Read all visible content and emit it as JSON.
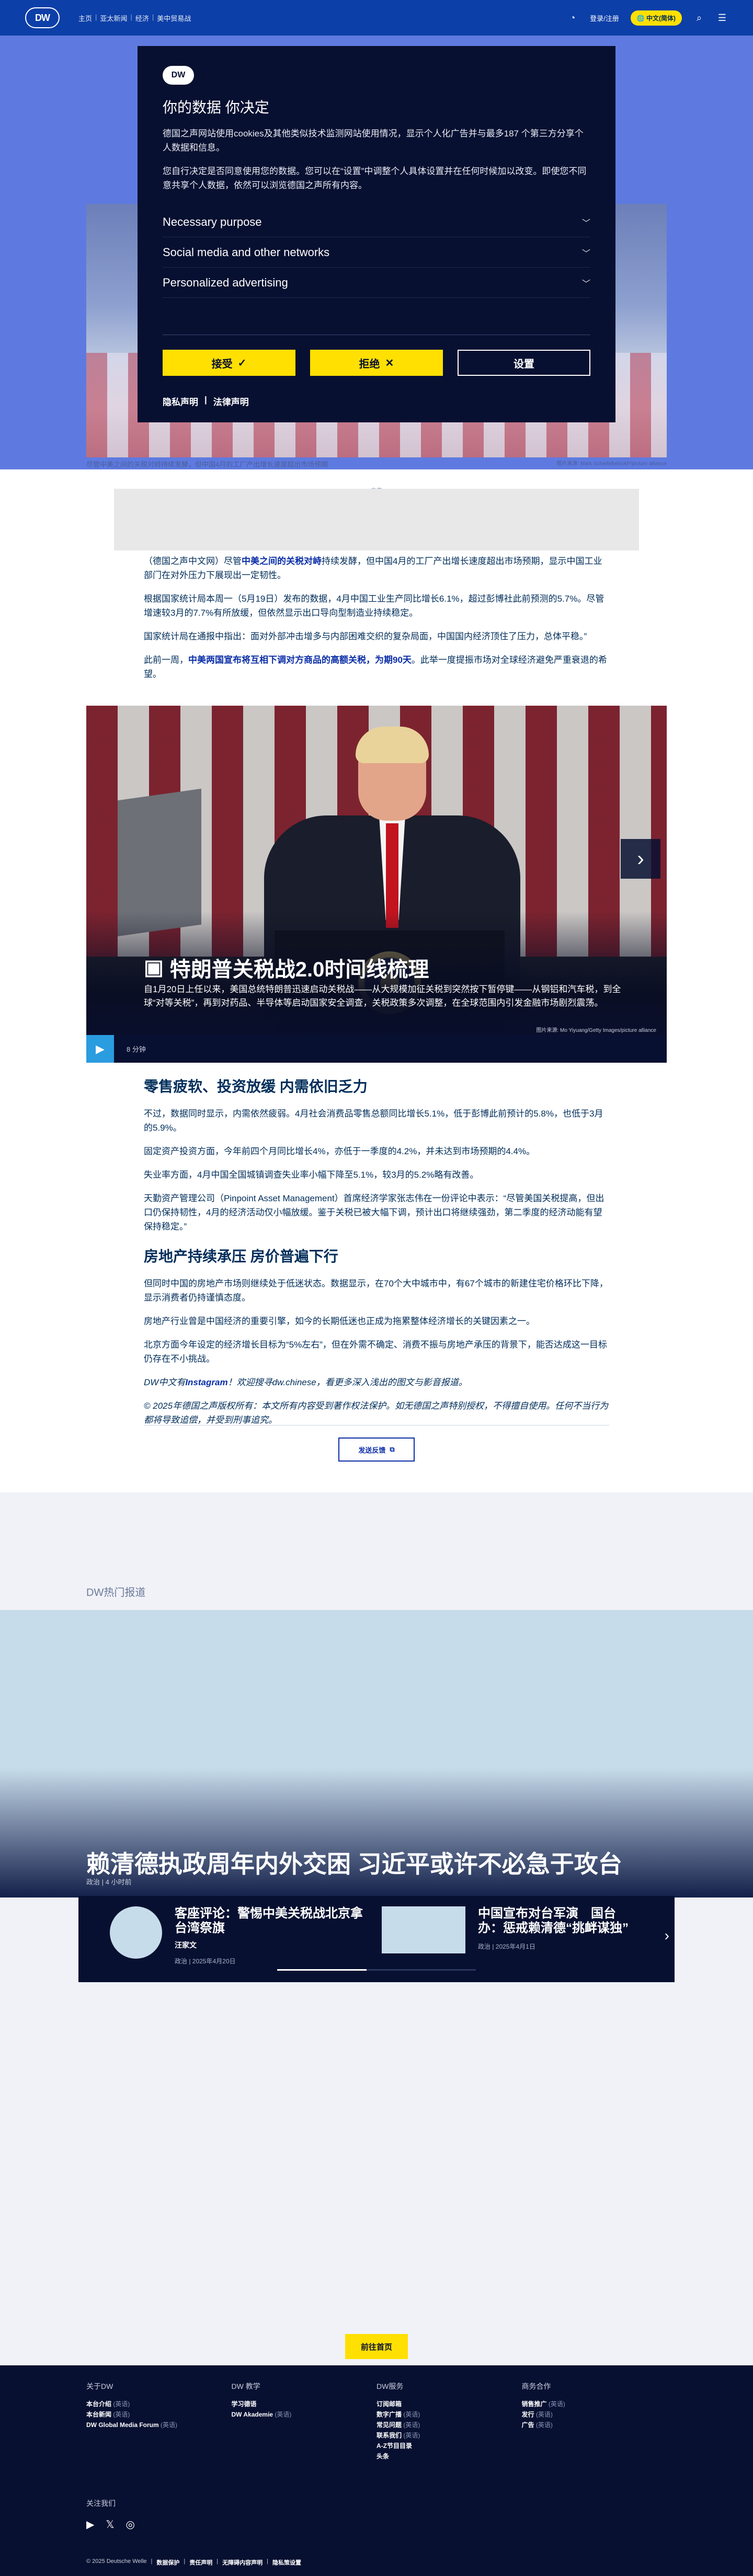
{
  "header": {
    "logo": "DW",
    "breadcrumbs": [
      "主页",
      "亚太新闻",
      "经济",
      "美中贸易战"
    ],
    "login_label": "登录/注册",
    "language_label": "中文(简体)",
    "search_icon": "search-icon",
    "menu_icon": "menu-icon"
  },
  "hero": {
    "caption": "尽管中美之间的关税对峙持续发酵，但中国4月的工厂产出增长速度超出市场预期",
    "credit": "图片来源: Mark Schiefelbein/AP/picture alliance"
  },
  "consent": {
    "logo": "DW",
    "title": "你的数据 你决定",
    "para1": "德国之声网站使用cookies及其他类似技术监测网站使用情况，显示个人化广告并与最多187 个第三方分享个人数据和信息。",
    "para2": "您自行决定是否同意使用您的数据。您可以在“设置”中调整个人具体设置并在任何时候加以改变。即使您不同意共享个人数据，依然可以浏览德国之声所有内容。",
    "rows": [
      "Necessary purpose",
      "Social media and other networks",
      "Personalized advertising"
    ],
    "accept_label": "接受",
    "reject_label": "拒绝",
    "settings_label": "设置",
    "privacy_link": "隐私声明",
    "legal_link": "法律声明"
  },
  "ad_label": "广告",
  "article": {
    "p1_pre": "（德国之声中文网）尽管",
    "p1_link": "中美之间的关税对峙",
    "p1_post": "持续发酵，但中国4月的工厂产出增长速度超出市场预期，显示中国工业部门在对外压力下展现出一定韧性。",
    "p2": "根据国家统计局本周一（5月19日）发布的数据，4月中国工业生产同比增长6.1%，超过彭博社此前预测的5.7%。尽管增速较3月的7.7%有所放缓，但依然显示出口导向型制造业持续稳定。",
    "p3": "国家统计局在通报中指出：面对外部冲击增多与内部困难交织的复杂局面，中国国内经济顶住了压力，总体平稳。”",
    "p4_pre": "此前一周，",
    "p4_link": "中美两国宣布将互相下调对方商品的高额关税，为期90天",
    "p4_post": "。此举一度提振市场对全球经济避免严重衰退的希望。"
  },
  "video": {
    "title": "特朗普关税战2.0时间线梳理",
    "description": "自1月20日上任以来，美国总统特朗普迅速启动关税战——从大规模加征关税到突然按下暂停键——从钢铝和汽车税，到全球“对等关税”，再到对药品、半导体等启动国家安全调查，关税政策多次调整，在全球范围内引发金融市场剧烈震荡。",
    "credit": "图片来源: Mo Yiyuang/Getty Images/picture alliance",
    "duration": "8 分钟"
  },
  "article2": {
    "h1": "零售疲软、投资放缓 内需依旧乏力",
    "p1": "不过，数据同时显示，内需依然疲弱。4月社会消费品零售总额同比增长5.1%，低于彭博此前预计的5.8%，也低于3月的5.9%。",
    "p2": "固定资产投资方面，今年前四个月同比增长4%，亦低于一季度的4.2%，并未达到市场预期的4.4%。",
    "p3": "失业率方面，4月中国全国城镇调查失业率小幅下降至5.1%，较3月的5.2%略有改善。",
    "p4": "天勤资产管理公司（Pinpoint Asset Management）首席经济学家张志伟在一份评论中表示：“尽管美国关税提高，但出口仍保持韧性，4月的经济活动仅小幅放缓。鉴于关税已被大幅下调，预计出口将继续强劲，第二季度的经济动能有望保持稳定。”",
    "h2": "房地产持续承压 房价普遍下行",
    "p5": "但同时中国的房地产市场则继续处于低迷状态。数据显示，在70个大中城市中，有67个城市的新建住宅价格环比下降，显示消费者仍持谨慎态度。",
    "p6": "房地产行业曾是中国经济的重要引擎，如今的长期低迷也正成为拖累整体经济增长的关键因素之一。",
    "p7": "北京方面今年设定的经济增长目标为“5%左右”，但在外需不确定、消费不振与房地产承压的背景下，能否达成这一目标仍存在不小挑战。",
    "note_pre": "DW中文有",
    "note_link": "Instagram",
    "note_post": "！欢迎搜寻dw.chinese，看更多深入浅出的图文与影音报道。",
    "copyright": "© 2025年德国之声版权所有：本文所有内容受到著作权法保护。如无德国之声特别授权，不得擅自使用。任何不当行为都将导致追偿，并受到刑事追究。",
    "feedback_label": "发送反馈"
  },
  "popular": {
    "label": "DW热门报道",
    "headline": "赖清德执政周年内外交困 习近平或许不必急于攻台",
    "meta": "政治 | 4 小时前",
    "items": [
      {
        "title": "客座评论：警惕中美关税战北京拿台湾祭旗",
        "author": "汪家文",
        "meta": "政治 | 2025年4月20日"
      },
      {
        "title": "中国宣布对台军演　国台办：惩戒赖清德“挑衅谋独”",
        "author": "",
        "meta": "政治 | 2025年4月1日"
      }
    ],
    "home_label": "前往首页"
  },
  "footer": {
    "cols": [
      {
        "title": "关于DW",
        "items": [
          [
            "本台介绍",
            "(英语)"
          ],
          [
            "本台新闻",
            "(英语)"
          ],
          [
            "DW Global Media Forum",
            "(英语)"
          ]
        ]
      },
      {
        "title": "DW 教学",
        "items": [
          [
            "学习德语",
            ""
          ],
          [
            "DW Akademie",
            "(英语)"
          ]
        ]
      },
      {
        "title": "DW服务",
        "items": [
          [
            "订阅邮箱",
            ""
          ],
          [
            "数字广播",
            "(英语)"
          ],
          [
            "常见问题",
            "(英语)"
          ],
          [
            "联系我们",
            "(英语)"
          ],
          [
            "A-Z节目目录",
            ""
          ],
          [
            "头条",
            ""
          ]
        ]
      },
      {
        "title": "商务合作",
        "items": [
          [
            "销售推广",
            "(英语)"
          ],
          [
            "发行",
            "(英语)"
          ],
          [
            "广告",
            "(英语)"
          ]
        ]
      }
    ],
    "follow": "关注我们",
    "social": [
      "youtube-icon",
      "x-icon",
      "instagram-icon"
    ],
    "bottom": [
      "© 2025 Deutsche Welle",
      "数据保护",
      "责任声明",
      "无障碍内容声明",
      "隐私策设置"
    ]
  }
}
